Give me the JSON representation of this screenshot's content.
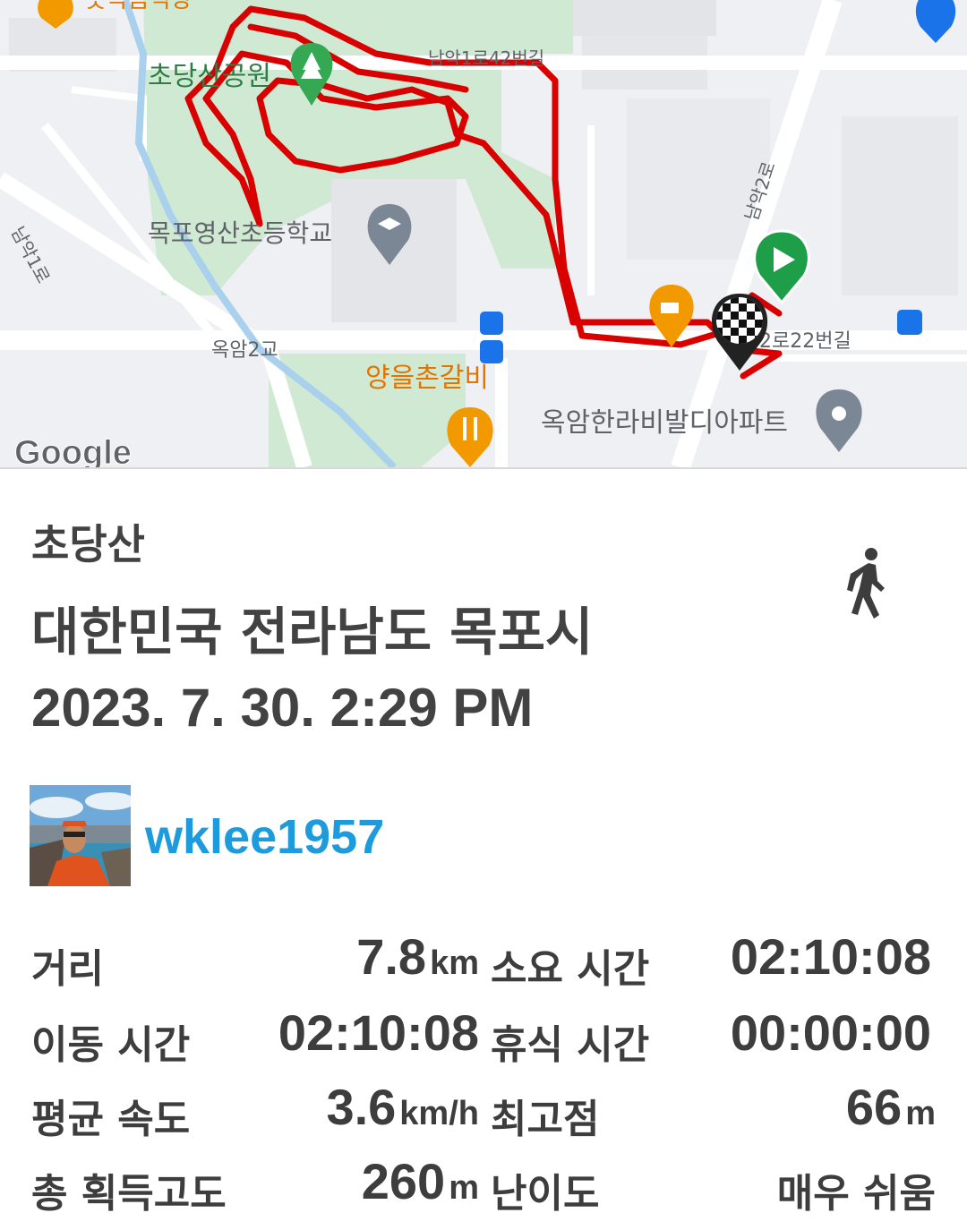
{
  "map": {
    "labels": {
      "park": "초당산공원",
      "school": "목포영산초등학교",
      "road_top": "남악1로42번길",
      "road_right": "남악2로",
      "road_left": "남악1로",
      "bridge": "옥암2교",
      "restaurant": "양을촌갈비",
      "apartment": "옥암한라비발디아파트",
      "road_bottom_right": "2로22번길",
      "partial_top": "곳곡음식장"
    },
    "logo": "Google",
    "route_color": "#d90000",
    "icons": [
      "park-tree-icon",
      "school-icon",
      "cafe-icon",
      "restaurant-icon",
      "apartment-pin-icon",
      "bus-stop-icon",
      "start-marker-icon",
      "finish-flag-icon"
    ]
  },
  "header": {
    "title": "초당산",
    "region": "대한민국 전라남도 목포시",
    "datetime": "2023. 7. 30. 2:29 PM",
    "activity_icon": "walking-icon"
  },
  "user": {
    "name": "wklee1957"
  },
  "stats": {
    "distance_label": "거리",
    "distance_value": "7.8",
    "distance_unit": "km",
    "duration_label": "소요 시간",
    "duration_value": "02:10:08",
    "moving_label": "이동 시간",
    "moving_value": "02:10:08",
    "rest_label": "휴식 시간",
    "rest_value": "00:00:00",
    "speed_label": "평균 속도",
    "speed_value": "3.6",
    "speed_unit": "km/h",
    "highest_label": "최고점",
    "highest_value": "66",
    "highest_unit": "m",
    "gain_label": "총 획득고도",
    "gain_value": "260",
    "gain_unit": "m",
    "difficulty_label": "난이도",
    "difficulty_value": "매우 쉬움"
  }
}
